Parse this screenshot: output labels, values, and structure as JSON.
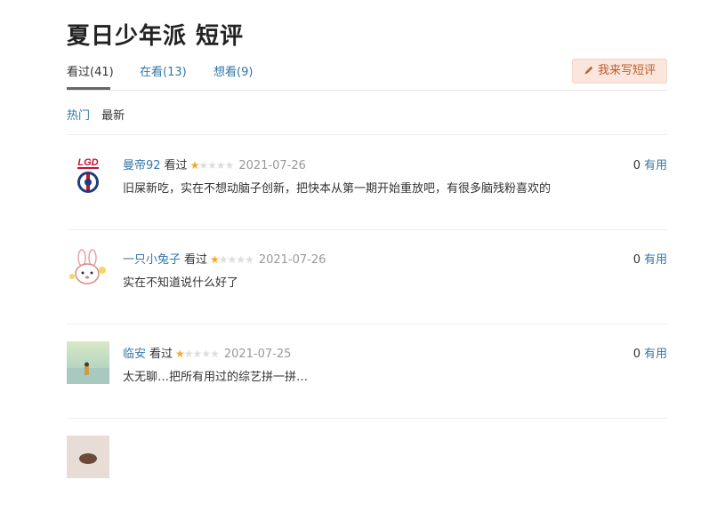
{
  "page": {
    "title": "夏日少年派 短评"
  },
  "tabs": [
    {
      "label": "看过(41)",
      "active": true
    },
    {
      "label": "在看(13)",
      "active": false
    },
    {
      "label": "想看(9)",
      "active": false
    }
  ],
  "write_button": {
    "label": "我来写短评",
    "icon": "pencil-icon"
  },
  "sort": {
    "hot": "热门",
    "new": "最新"
  },
  "colors": {
    "link": "#3377aa",
    "star": "#f5a623",
    "button_bg": "#fae6dc",
    "button_text": "#c05a2e"
  },
  "reviews": [
    {
      "user": "曼帝92",
      "status": "看过",
      "rating": 1,
      "date": "2021-07-26",
      "useful_count": "0",
      "useful_label": "有用",
      "text": "旧屎新吃，实在不想动脑子创新，把快本从第一期开始重放吧，有很多脑残粉喜欢的"
    },
    {
      "user": "一只小兔子",
      "status": "看过",
      "rating": 1,
      "date": "2021-07-26",
      "useful_count": "0",
      "useful_label": "有用",
      "text": "实在不知道说什么好了"
    },
    {
      "user": "临安",
      "status": "看过",
      "rating": 1,
      "date": "2021-07-25",
      "useful_count": "0",
      "useful_label": "有用",
      "text": "太无聊…把所有用过的综艺拼一拼…"
    }
  ]
}
